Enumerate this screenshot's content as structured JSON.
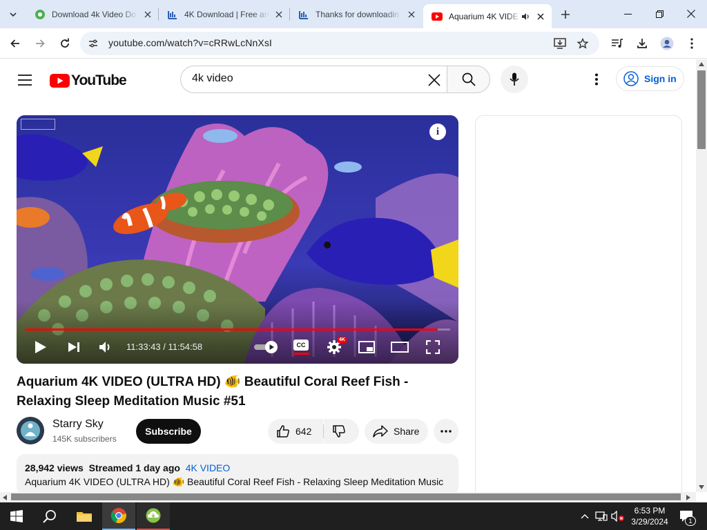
{
  "browser": {
    "tabs": [
      {
        "title": "Download 4k Video Do",
        "favicon": "green-download-icon",
        "active": false
      },
      {
        "title": "4K Download | Free an",
        "favicon": "blue-chart-icon",
        "active": false
      },
      {
        "title": "Thanks for downloadin",
        "favicon": "blue-chart-icon",
        "active": false
      },
      {
        "title": "Aquarium 4K VIDE",
        "favicon": "youtube-icon",
        "active": true,
        "audio": true
      }
    ],
    "url": "youtube.com/watch?v=cRRwLcNnXsI"
  },
  "youtube": {
    "logo_text": "YouTube",
    "search_value": "4k video",
    "signin_label": "Sign in"
  },
  "player": {
    "time_label": "11:33:43 / 11:54:58",
    "progress": 0.9703,
    "hd_badge": "4K",
    "cc_label": "CC"
  },
  "video": {
    "title": "Aquarium 4K VIDEO (ULTRA HD) 🐠 Beautiful Coral Reef Fish - Relaxing Sleep Meditation Music #51",
    "channel_name": "Starry Sky",
    "subscribers": "145K subscribers",
    "subscribe_label": "Subscribe",
    "like_count": "642",
    "share_label": "Share",
    "views": "28,942 views",
    "streamed": "Streamed 1 day ago",
    "tag": "4K VIDEO",
    "description": "Aquarium 4K VIDEO (ULTRA HD) 🐠 Beautiful Coral Reef Fish - Relaxing Sleep Meditation Music"
  },
  "taskbar": {
    "time": "6:53 PM",
    "date": "3/29/2024",
    "notification_count": "1"
  },
  "colors": {
    "tabstrip_bg": "#dfe8f7",
    "youtube_red": "#ff0000",
    "link_blue": "#065fd4",
    "taskbar_bg": "#1f1f1f"
  }
}
